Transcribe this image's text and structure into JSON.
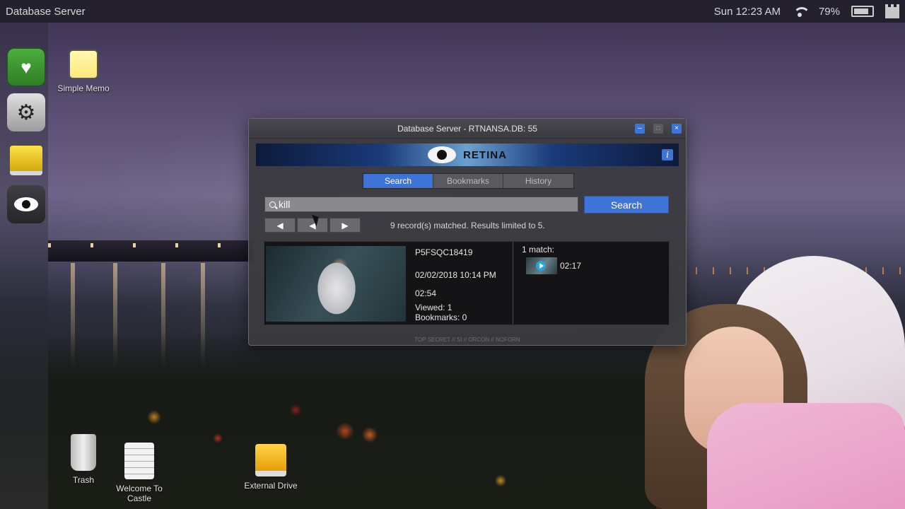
{
  "topbar": {
    "app_title": "Database Server",
    "clock": "Sun 12:23 AM",
    "battery": "79%"
  },
  "dock": {
    "items": [
      "cards-icon",
      "gears-icon",
      "drive-icon",
      "eye-icon"
    ]
  },
  "desktop": {
    "icons": {
      "memo": "Simple Memo",
      "trash": "Trash",
      "welcome": "Welcome To Castle",
      "external": "External Drive"
    }
  },
  "window": {
    "title": "Database Server - RTNANSA.DB: 55",
    "banner_title": "RETINA",
    "info_label": "i",
    "tabs": [
      "Search",
      "Bookmarks",
      "History"
    ],
    "active_tab": "Search",
    "search": {
      "value": "kill",
      "button_label": "Search"
    },
    "status": "9 record(s) matched. Results limited to 5.",
    "result": {
      "id": "P5FSQC18419",
      "date": "02/02/2018 10:14 PM",
      "duration": "02:54",
      "viewed": "Viewed: 1",
      "bookmarks": "Bookmarks: 0",
      "match_count": "1 match:",
      "match_time": "02:17"
    },
    "classification": "TOP SECRET // SI // ORCON // NOFORN"
  },
  "colors": {
    "accent": "#3f73d6",
    "window_bg": "#3a3a3e"
  }
}
